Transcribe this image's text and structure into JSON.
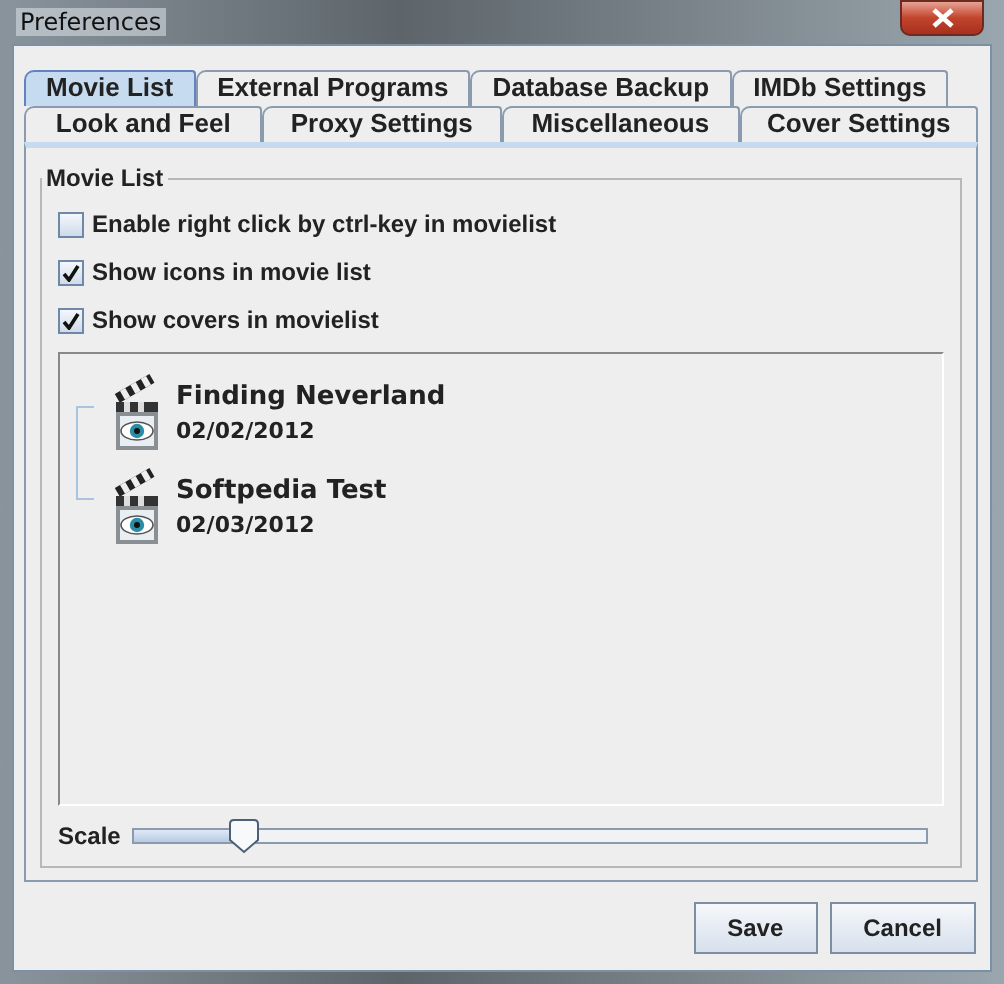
{
  "window": {
    "title": "Preferences"
  },
  "tab_rows": [
    [
      {
        "label": "Movie List",
        "selected": true
      },
      {
        "label": "External Programs",
        "selected": false
      },
      {
        "label": "Database Backup",
        "selected": false
      },
      {
        "label": "IMDb Settings",
        "selected": false
      }
    ],
    [
      {
        "label": "Look and Feel",
        "selected": false
      },
      {
        "label": "Proxy Settings",
        "selected": false
      },
      {
        "label": "Miscellaneous",
        "selected": false
      },
      {
        "label": "Cover Settings",
        "selected": false
      }
    ]
  ],
  "group": {
    "title": "Movie List",
    "options": [
      {
        "label": "Enable right click by ctrl-key in movielist",
        "checked": false
      },
      {
        "label": "Show icons in movie list",
        "checked": true
      },
      {
        "label": "Show covers in movielist",
        "checked": true
      }
    ],
    "movies": [
      {
        "title": "Finding Neverland",
        "date": "02/02/2012"
      },
      {
        "title": "Softpedia Test",
        "date": "02/03/2012"
      }
    ],
    "scale": {
      "label": "Scale",
      "level": 0.14
    }
  },
  "buttons": [
    "Save",
    "Cancel"
  ]
}
